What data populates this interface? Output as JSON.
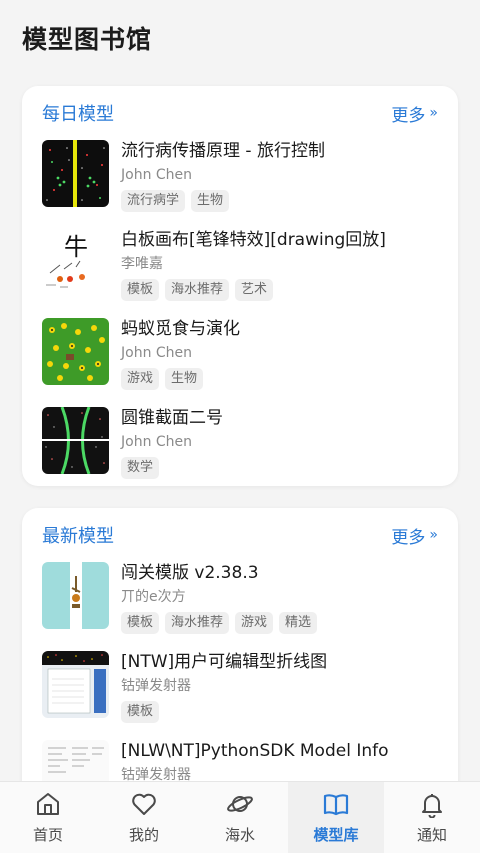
{
  "app": {
    "title": "模型图书馆"
  },
  "sections": {
    "daily": {
      "title": "每日模型",
      "more": "更多",
      "items": [
        {
          "title": "流行病传播原理 - 旅行控制",
          "author": "John Chen",
          "tags": [
            "流行病学",
            "生物"
          ]
        },
        {
          "title": "白板画布[笔锋特效][drawing回放]",
          "author": "李唯嘉",
          "tags": [
            "模板",
            "海水推荐",
            "艺术"
          ]
        },
        {
          "title": "蚂蚁觅食与演化",
          "author": "John Chen",
          "tags": [
            "游戏",
            "生物"
          ]
        },
        {
          "title": "圆锥截面二号",
          "author": "John Chen",
          "tags": [
            "数学"
          ]
        }
      ]
    },
    "latest": {
      "title": "最新模型",
      "more": "更多",
      "items": [
        {
          "title": "闯关模版 v2.38.3",
          "author": "丌的e次方",
          "tags": [
            "模板",
            "海水推荐",
            "游戏",
            "精选"
          ]
        },
        {
          "title": "[NTW]用户可编辑型折线图",
          "author": "钴弹发射器",
          "tags": [
            "模板"
          ]
        },
        {
          "title": "[NLW\\NT]PythonSDK Model Info",
          "author": "钴弹发射器",
          "tags": []
        }
      ]
    }
  },
  "thumb_text": {
    "whiteboard": "牛"
  },
  "tabs": [
    {
      "label": "首页",
      "icon": "home-icon",
      "active": false
    },
    {
      "label": "我的",
      "icon": "heart-icon",
      "active": false
    },
    {
      "label": "海水",
      "icon": "planet-icon",
      "active": false
    },
    {
      "label": "模型库",
      "icon": "book-icon",
      "active": true
    },
    {
      "label": "通知",
      "icon": "bell-icon",
      "active": false
    }
  ],
  "colors": {
    "accent": "#2a7ad6",
    "tag_bg": "#efefef"
  }
}
